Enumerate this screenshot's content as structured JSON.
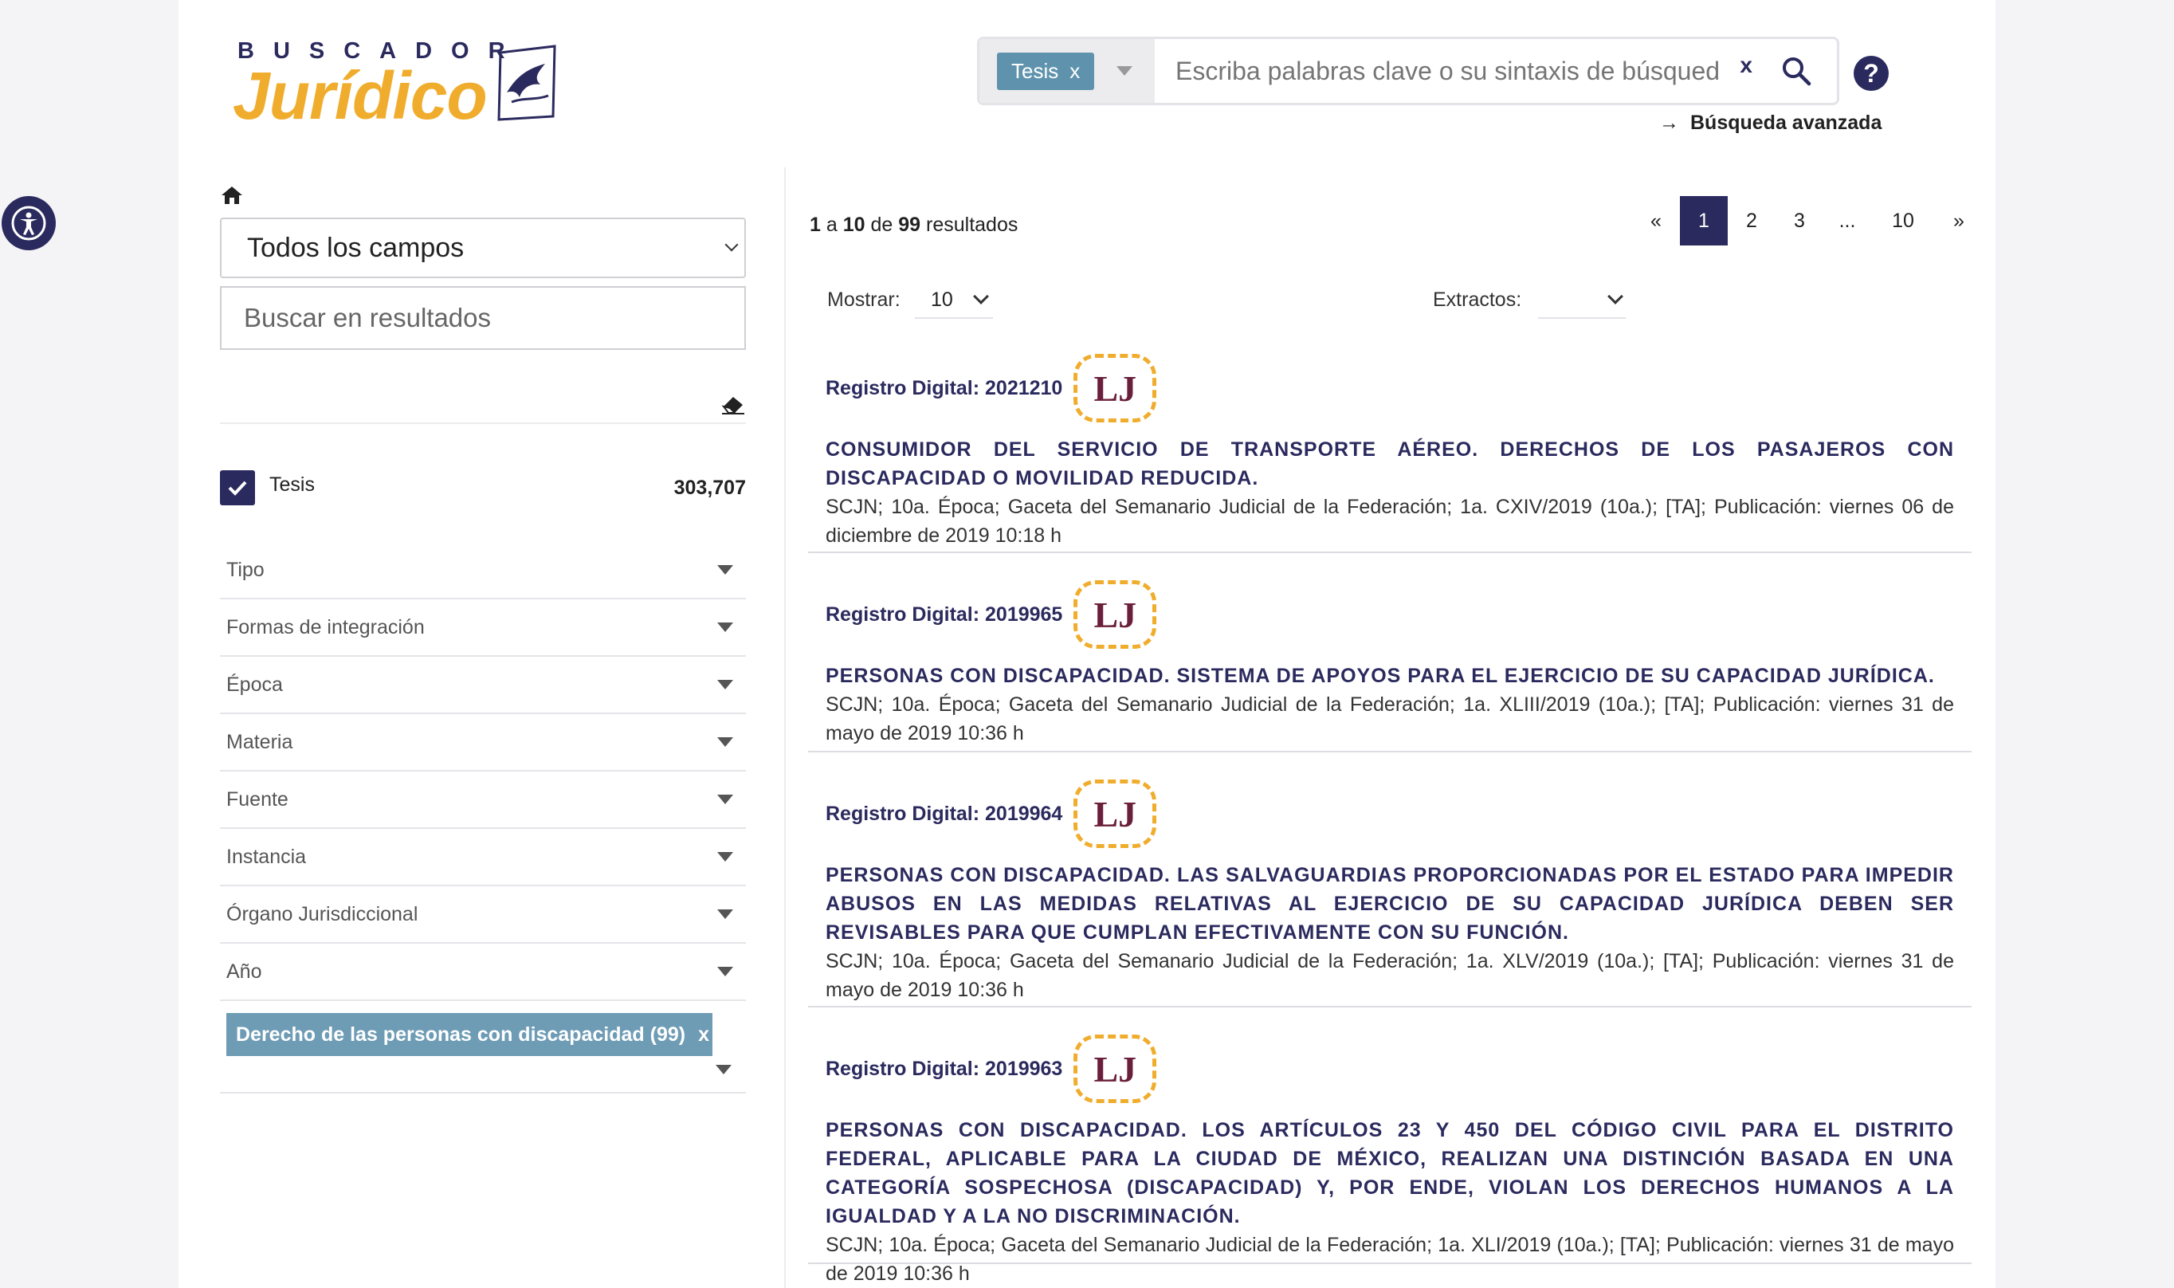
{
  "logo": {
    "top_text": "BUSCADOR",
    "main_text": "Jurídico"
  },
  "search": {
    "type_chip": "Tesis",
    "type_chip_close": "x",
    "placeholder": "Escriba palabras clave o su sintaxis de búsqued",
    "clear_label": "x",
    "help_label": "?",
    "advanced_label": "Búsqueda avanzada",
    "advanced_arrow": "→"
  },
  "sidebar": {
    "field_select": "Todos los campos",
    "results_search_placeholder": "Buscar en resultados",
    "tesis_label": "Tesis",
    "tesis_count": "303,707",
    "facets": [
      "Tipo",
      "Formas de integración",
      "Época",
      "Materia",
      "Fuente",
      "Instancia",
      "Órgano Jurisdiccional",
      "Año"
    ],
    "active_filter": "Derecho de las personas con discapacidad (99)",
    "active_filter_close": "x"
  },
  "results_header": {
    "from": "1",
    "a": "a",
    "to": "10",
    "de": "de",
    "total": "99",
    "suffix": "resultados",
    "pager": {
      "prev": "«",
      "pages": [
        "1",
        "2",
        "3"
      ],
      "ellipsis": "...",
      "last": "10",
      "next": "»"
    },
    "show_label": "Mostrar:",
    "show_value": "10",
    "extract_label": "Extractos:"
  },
  "results": [
    {
      "registro": "Registro Digital: 2021210",
      "badge": "LJ",
      "title": "CONSUMIDOR DEL SERVICIO DE TRANSPORTE AÉREO. DERECHOS DE LOS PASAJEROS CON DISCAPACIDAD O MOVILIDAD REDUCIDA.",
      "meta": "SCJN; 10a. Época; Gaceta del Semanario Judicial de la Federación; 1a. CXIV/2019 (10a.); [TA]; Publicación: viernes 06 de diciembre de 2019 10:18 h"
    },
    {
      "registro": "Registro Digital: 2019965",
      "badge": "LJ",
      "title": "PERSONAS CON DISCAPACIDAD. SISTEMA DE APOYOS PARA EL EJERCICIO DE SU CAPACIDAD JURÍDICA.",
      "meta": "SCJN; 10a. Época; Gaceta del Semanario Judicial de la Federación; 1a. XLIII/2019 (10a.); [TA]; Publicación: viernes 31 de mayo de 2019 10:36 h"
    },
    {
      "registro": "Registro Digital: 2019964",
      "badge": "LJ",
      "title": "PERSONAS CON DISCAPACIDAD. LAS SALVAGUARDIAS PROPORCIONADAS POR EL ESTADO PARA IMPEDIR ABUSOS EN LAS MEDIDAS RELATIVAS AL EJERCICIO DE SU CAPACIDAD JURÍDICA DEBEN SER REVISABLES PARA QUE CUMPLAN EFECTIVAMENTE CON SU FUNCIÓN.",
      "meta": "SCJN; 10a. Época; Gaceta del Semanario Judicial de la Federación; 1a. XLV/2019 (10a.); [TA]; Publicación: viernes 31 de mayo de 2019 10:36 h"
    },
    {
      "registro": "Registro Digital: 2019963",
      "badge": "LJ",
      "title": "PERSONAS CON DISCAPACIDAD. LOS ARTÍCULOS 23 Y 450 DEL CÓDIGO CIVIL PARA EL DISTRITO FEDERAL, APLICABLE PARA LA CIUDAD DE MÉXICO, REALIZAN UNA DISTINCIÓN BASADA EN UNA CATEGORÍA SOSPECHOSA (DISCAPACIDAD) Y, POR ENDE, VIOLAN LOS DERECHOS HUMANOS A LA IGUALDAD Y A LA NO DISCRIMINACIÓN.",
      "meta": "SCJN; 10a. Época; Gaceta del Semanario Judicial de la Federación; 1a. XLI/2019 (10a.); [TA]; Publicación: viernes 31 de mayo de 2019 10:36 h"
    }
  ],
  "colors": {
    "brand": "#2b2a5e",
    "accent": "#f0ad2d",
    "chip": "#5f93ad"
  },
  "icons": [
    "accessibility-icon",
    "search-icon",
    "home-icon",
    "eraser-icon",
    "check-icon",
    "chevron-down-icon",
    "eagle-emblem-icon"
  ]
}
